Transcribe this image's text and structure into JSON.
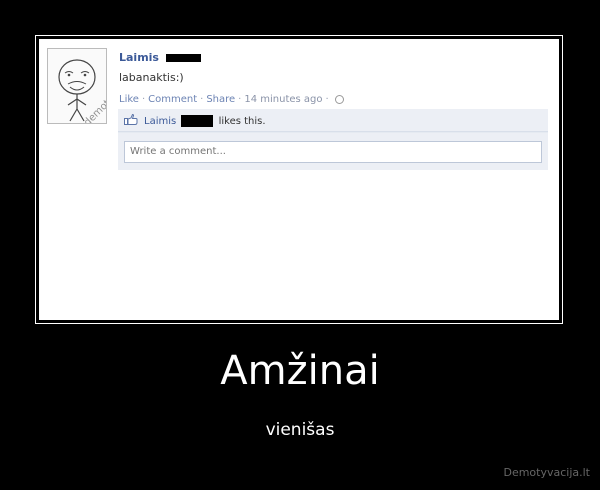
{
  "post": {
    "author": "Laimis",
    "status": "labanaktis:)",
    "actions": {
      "like": "Like",
      "comment": "Comment",
      "share": "Share",
      "time": "14 minutes ago"
    },
    "likes": {
      "name": "Laimis",
      "suffix": "likes this."
    },
    "comment_placeholder": "Write a comment...",
    "avatar_icon": "forever-alone-face-icon",
    "watermark": "demotyvacija.lt"
  },
  "poster": {
    "title": "Amžinai",
    "subtitle": "vienišas",
    "site": "Demotyvacija.lt"
  },
  "colors": {
    "background": "#000000",
    "link": "#3b5998",
    "ufi_background": "#eceff5"
  }
}
